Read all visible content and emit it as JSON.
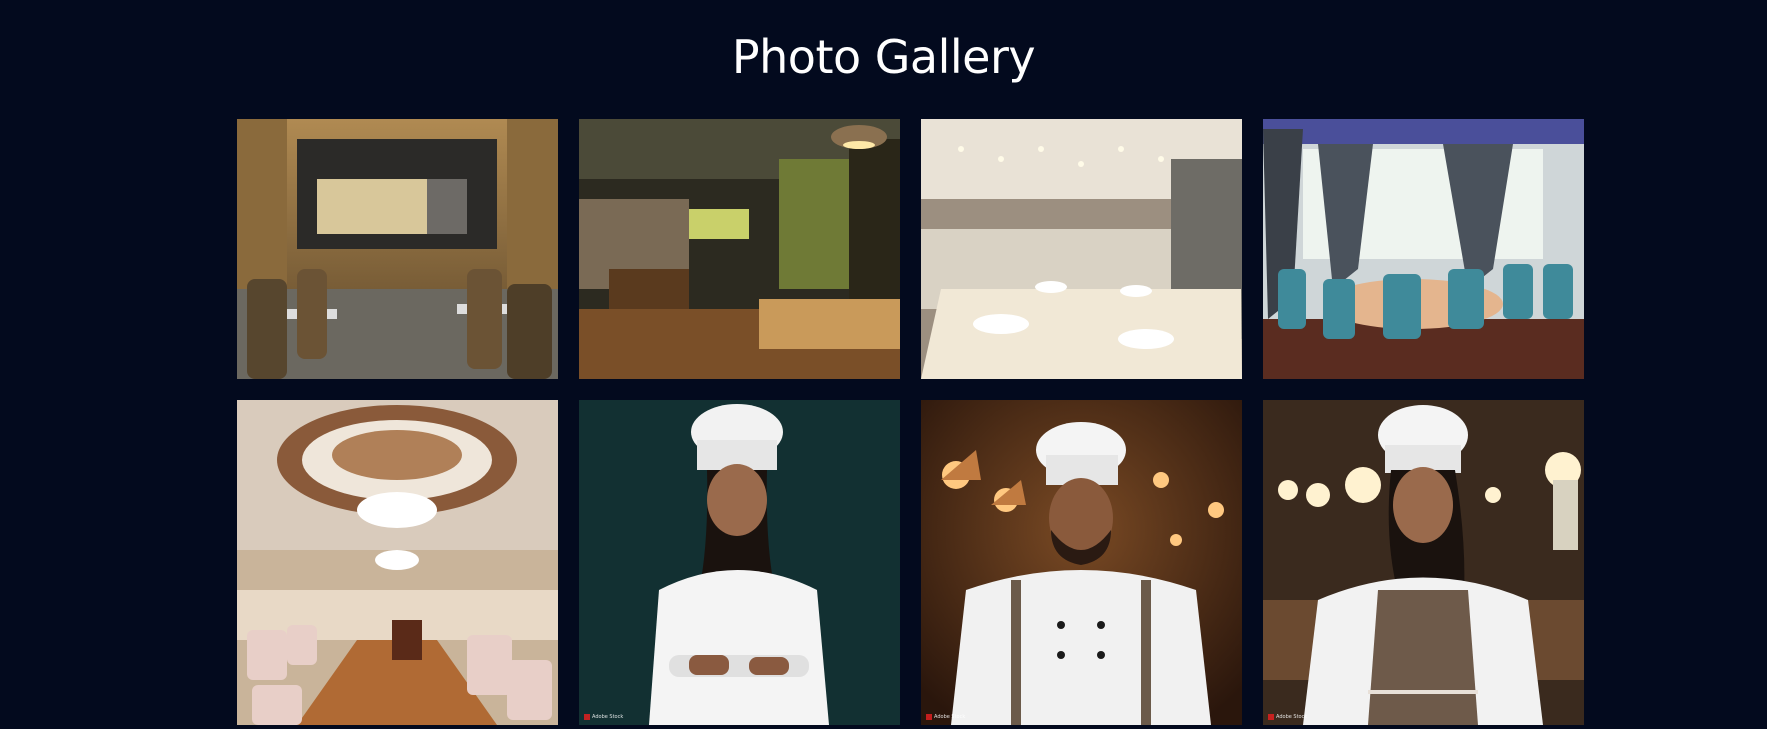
{
  "gallery": {
    "title": "Photo Gallery",
    "photos": [
      {
        "subject": "restaurant interior with wooden chairs and patterned tile floor"
      },
      {
        "subject": "dim restaurant with pendant lamps and wooden tables"
      },
      {
        "subject": "bright dining room with white tablecloths and folded napkins"
      },
      {
        "subject": "banquet hall with teal velvet chairs and grey curtains"
      },
      {
        "subject": "grand hall with chandeliers and ornate ceiling dome"
      },
      {
        "subject": "female chef in white hat with arms crossed"
      },
      {
        "subject": "male chef with beard in white uniform and apron"
      },
      {
        "subject": "smiling female chef in brown apron in restaurant kitchen"
      }
    ]
  },
  "colors": {
    "background": "#030a1e",
    "title": "#ffffff"
  }
}
